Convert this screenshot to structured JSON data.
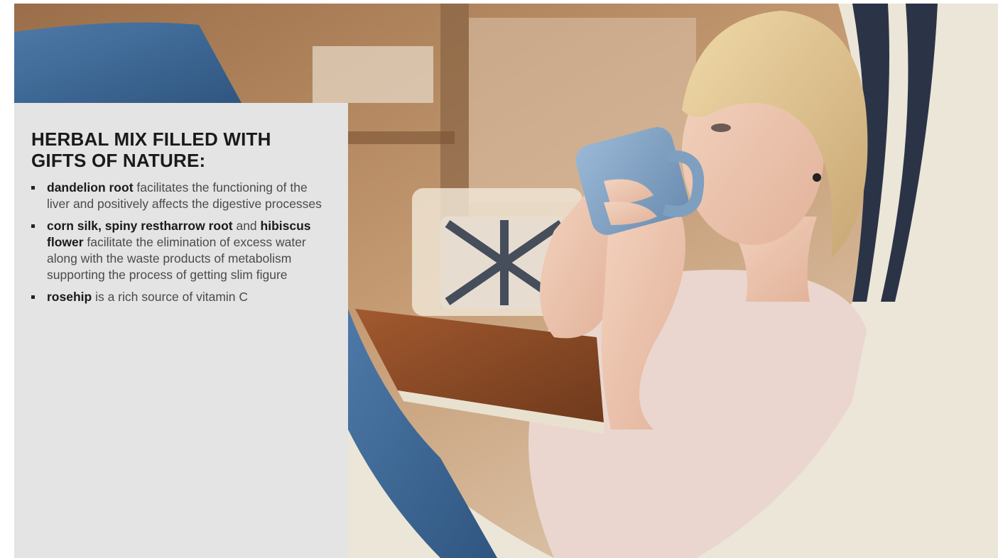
{
  "heading": "HERBAL MIX FILLED WITH GIFTS OF NATURE:",
  "benefits": [
    {
      "parts": [
        {
          "text": "dandelion root",
          "bold": true
        },
        {
          "text": " facilitates the functioning of the liver and positively affects the digestive processes",
          "bold": false
        }
      ]
    },
    {
      "parts": [
        {
          "text": "corn silk, spiny restharrow root",
          "bold": true
        },
        {
          "text": " and ",
          "bold": false
        },
        {
          "text": "hibiscus flower",
          "bold": true
        },
        {
          "text": " facilitate the elimination of excess water along with the waste products of metabolism supporting the process of getting slim figure",
          "bold": false
        }
      ]
    },
    {
      "parts": [
        {
          "text": "rosehip",
          "bold": true
        },
        {
          "text": " is a rich source of vitamin C",
          "bold": false
        }
      ]
    }
  ],
  "colors": {
    "panel_bg": "#e4e4e4",
    "heading": "#1a1a1a",
    "body_text": "#4a4a4a",
    "mug": "#7f9fc0",
    "book_cover": "#8a4a28",
    "hammock": "#ece6d8",
    "hammock_stripe": "#2b3447"
  },
  "photo_subject": "woman-drinking-tea-in-hammock"
}
